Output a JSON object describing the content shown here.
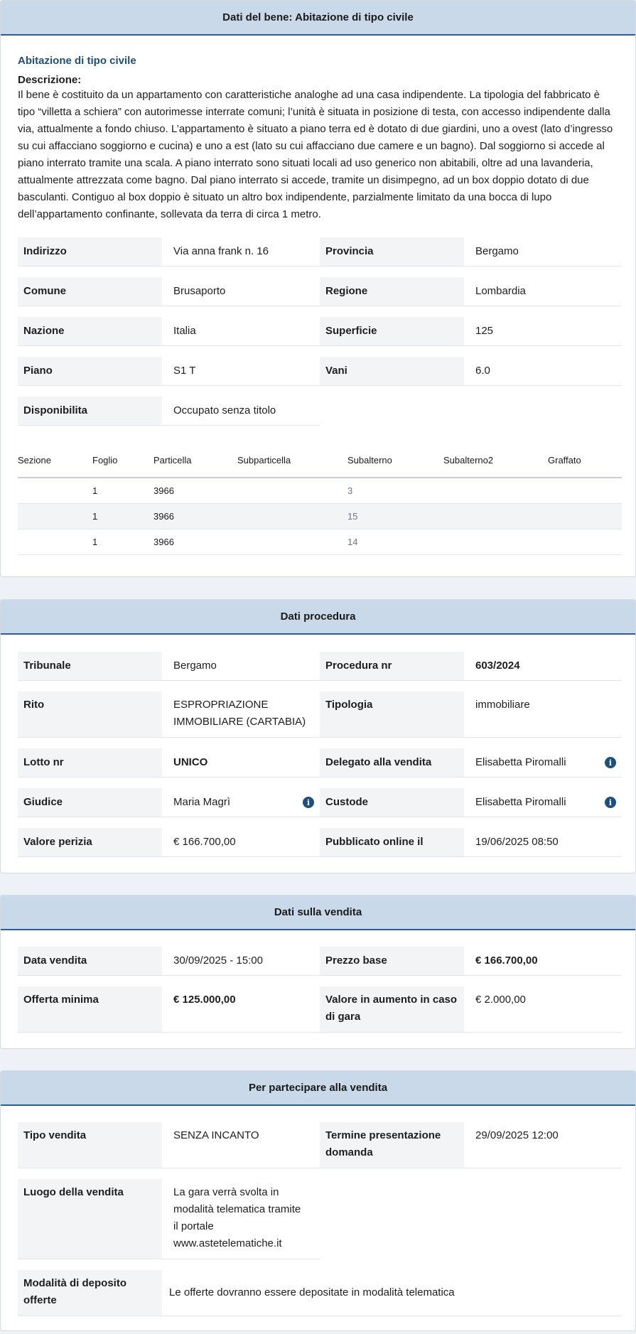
{
  "bene": {
    "header": "Dati del bene: Abitazione di tipo civile",
    "subtitle": "Abitazione di tipo civile",
    "desc_label": "Descrizione:",
    "description": "Il bene è costituito da un appartamento con caratteristiche analoghe ad una casa indipendente. La tipologia del fabbricato è tipo “villetta a schiera” con autorimesse interrate comuni; l’unità è situata in posizione di testa, con accesso indipendente dalla via, attualmente a fondo chiuso. L’appartamento è situato a piano terra ed è dotato di due giardini, uno a ovest (lato d’ingresso su cui affacciano soggiorno e cucina) e uno a est (lato su cui affacciano due camere e un bagno). Dal soggiorno si accede al piano interrato tramite una scala. A piano interrato sono situati locali ad uso generico non abitabili, oltre ad una lavanderia, attualmente attrezzata come bagno. Dal piano interrato si accede, tramite un disimpegno, ad un box doppio dotato di due basculanti. Contiguo al box doppio è situato un altro box indipendente, parzialmente limitato da una bocca di lupo dell’appartamento confinante, sollevata da terra di circa 1 metro.",
    "fields": {
      "indirizzo": {
        "label": "Indirizzo",
        "value": "Via anna frank n. 16"
      },
      "provincia": {
        "label": "Provincia",
        "value": "Bergamo"
      },
      "comune": {
        "label": "Comune",
        "value": "Brusaporto"
      },
      "regione": {
        "label": "Regione",
        "value": "Lombardia"
      },
      "nazione": {
        "label": "Nazione",
        "value": "Italia"
      },
      "superficie": {
        "label": "Superficie",
        "value": "125"
      },
      "piano": {
        "label": "Piano",
        "value": "S1 T"
      },
      "vani": {
        "label": "Vani",
        "value": "6.0"
      },
      "disponibilita": {
        "label": "Disponibilita",
        "value": "Occupato senza titolo"
      }
    },
    "catasto": {
      "headers": [
        "Sezione",
        "Foglio",
        "Particella",
        "Subparticella",
        "Subalterno",
        "Subalterno2",
        "Graffato"
      ],
      "rows": [
        [
          "",
          "1",
          "3966",
          "",
          "3",
          "",
          ""
        ],
        [
          "",
          "1",
          "3966",
          "",
          "15",
          "",
          ""
        ],
        [
          "",
          "1",
          "3966",
          "",
          "14",
          "",
          ""
        ]
      ]
    }
  },
  "procedura": {
    "header": "Dati procedura",
    "fields": {
      "tribunale": {
        "label": "Tribunale",
        "value": "Bergamo"
      },
      "procedura_nr": {
        "label": "Procedura nr",
        "value": "603/2024"
      },
      "rito": {
        "label": "Rito",
        "value": "ESPROPRIAZIONE IMMOBILIARE (CARTABIA)"
      },
      "tipologia": {
        "label": "Tipologia",
        "value": "immobiliare"
      },
      "lotto_nr": {
        "label": "Lotto nr",
        "value": "UNICO"
      },
      "delegato": {
        "label": "Delegato alla vendita",
        "value": "Elisabetta Piromalli"
      },
      "giudice": {
        "label": "Giudice",
        "value": "Maria Magrì"
      },
      "custode": {
        "label": "Custode",
        "value": "Elisabetta Piromalli"
      },
      "valore_perizia": {
        "label": "Valore perizia",
        "value": "€ 166.700,00"
      },
      "pubblicato": {
        "label": "Pubblicato online il",
        "value": "19/06/2025 08:50"
      }
    }
  },
  "vendita": {
    "header": "Dati sulla vendita",
    "fields": {
      "data_vendita": {
        "label": "Data vendita",
        "value": "30/09/2025 - 15:00"
      },
      "prezzo_base": {
        "label": "Prezzo base",
        "value": "€ 166.700,00"
      },
      "offerta_minima": {
        "label": "Offerta minima",
        "value": "€ 125.000,00"
      },
      "aumento": {
        "label": "Valore in aumento in caso di gara",
        "value": "€ 2.000,00"
      }
    }
  },
  "partecipare": {
    "header": "Per partecipare alla vendita",
    "fields": {
      "tipo_vendita": {
        "label": "Tipo vendita",
        "value": "SENZA INCANTO"
      },
      "termine": {
        "label": "Termine presentazione domanda",
        "value": "29/09/2025 12:00"
      },
      "luogo": {
        "label": "Luogo della vendita",
        "value": "La gara verrà svolta in modalità telematica tramite il portale www.astetelematiche.it"
      },
      "deposito": {
        "label": "Modalità di deposito offerte",
        "value": "Le offerte dovranno essere depositate in modalità telematica"
      }
    }
  },
  "colors": {
    "header_bg": "#c9d9ea",
    "header_border": "#2c5f8f",
    "label_bg": "#f2f4f6",
    "accent": "#1f4f7a",
    "info_icon": "#1d4f80"
  }
}
